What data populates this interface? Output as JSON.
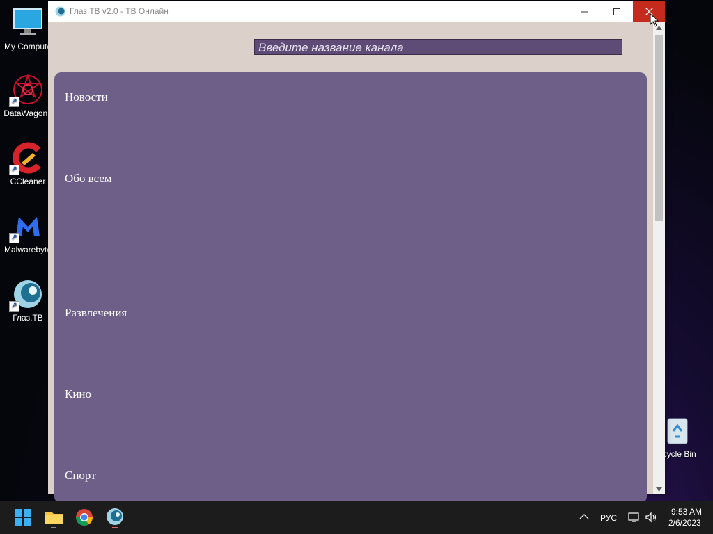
{
  "desktop": {
    "icons": [
      {
        "label": "My Compute"
      },
      {
        "label": "DataWagon.."
      },
      {
        "label": "CCleaner"
      },
      {
        "label": "Malwarebyte"
      },
      {
        "label": "Глаз.ТВ"
      }
    ],
    "recycle_bin": {
      "label": "ecycle Bin"
    }
  },
  "window": {
    "title": "Глаз.ТВ v2.0 - ТВ Онлайн",
    "search": {
      "placeholder": "Введите название канала"
    },
    "categories": [
      "Новости",
      "Обо всем",
      "Развлечения",
      "Кино",
      "Спорт"
    ],
    "colors": {
      "panel": "#6e5f89",
      "background": "#dcd0cb",
      "close": "#c42b1c"
    }
  },
  "taskbar": {
    "language": "РУС",
    "time": "9:53 AM",
    "date": "2/6/2023"
  }
}
